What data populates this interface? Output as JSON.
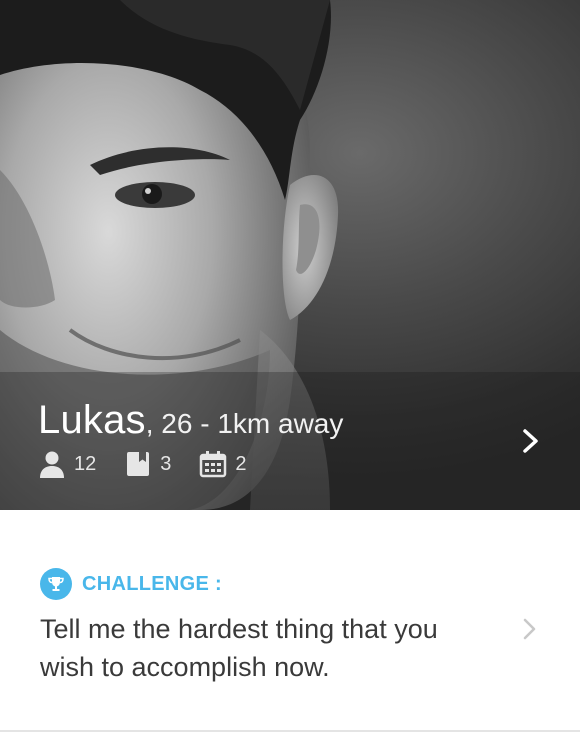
{
  "profile": {
    "name": "Lukas",
    "meta": ", 26 - 1km away",
    "stats": [
      {
        "icon": "person-icon",
        "count": "12"
      },
      {
        "icon": "book-icon",
        "count": "3"
      },
      {
        "icon": "calendar-icon",
        "count": "2"
      }
    ]
  },
  "challenge": {
    "label": "CHALLENGE :",
    "text": "Tell me the hardest thing that you wish to accomplish now.",
    "icon": "trophy-icon"
  },
  "colors": {
    "accent": "#49b7ea",
    "text": "#3a3a3a",
    "overlay_text": "#ffffff"
  }
}
